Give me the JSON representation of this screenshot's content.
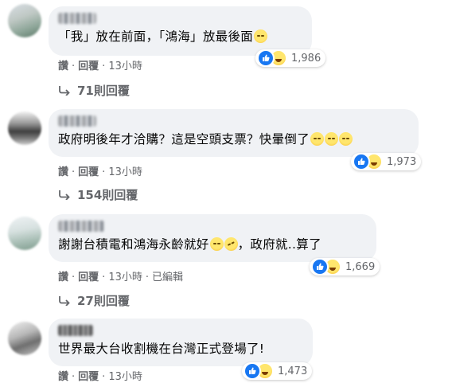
{
  "comments": [
    {
      "text": "「我」放在前面，「鴻海」放最後面",
      "emoji": "emoji-sad-face",
      "reaction_count": "1,986",
      "actions": {
        "like": "讚",
        "reply": "回覆",
        "time": "13小時"
      },
      "replies_label": "71則回覆"
    },
    {
      "text": "政府明後年才洽購？這是空頭支票？快暈倒了",
      "emoji": "emoji-tired-face",
      "reaction_count": "1,973",
      "actions": {
        "like": "讚",
        "reply": "回覆",
        "time": "13小時"
      },
      "replies_label": "154則回覆"
    },
    {
      "text": "謝謝台積電和鴻海永齡就好",
      "text_after": "，政府就..算了",
      "emoji": "emoji-laughing-face",
      "reaction_count": "1,669",
      "actions": {
        "like": "讚",
        "reply": "回覆",
        "time": "13小時",
        "edited": "已編輯"
      },
      "replies_label": "27則回覆"
    },
    {
      "text": "世界最大台收割機在台灣正式登場了!",
      "reaction_count": "1,473",
      "actions": {
        "like": "讚",
        "reply": "回覆",
        "time": "13小時"
      }
    }
  ],
  "colors": {
    "bubble": "#f0f2f5",
    "meta_text": "#65676b",
    "like_blue": "#1877f2",
    "haha_yellow": "#f7b928"
  },
  "icons": [
    "like-icon",
    "haha-icon",
    "reply-arrow-icon"
  ]
}
